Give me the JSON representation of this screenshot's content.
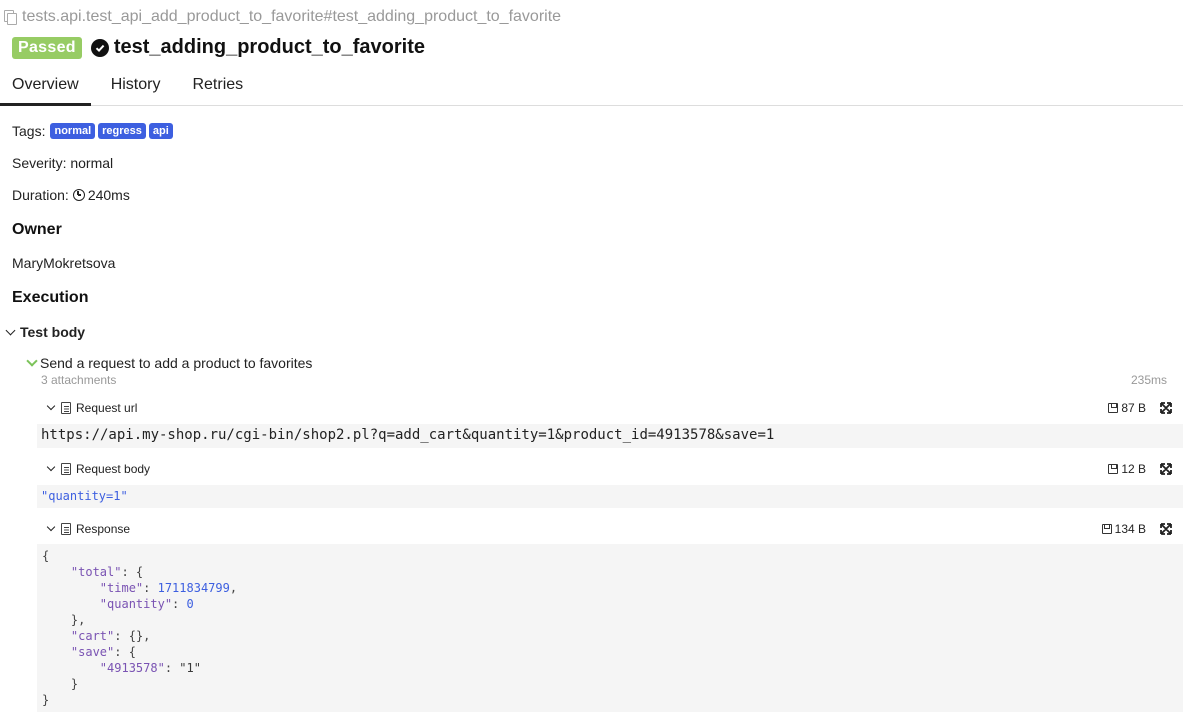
{
  "breadcrumb": "tests.api.test_api_add_product_to_favorite#test_adding_product_to_favorite",
  "status": "Passed",
  "title": "test_adding_product_to_favorite",
  "tabs": [
    "Overview",
    "History",
    "Retries"
  ],
  "tags_label": "Tags:",
  "tags": [
    "normal",
    "regress",
    "api"
  ],
  "severity": "Severity: normal",
  "duration_label": "Duration:",
  "duration_value": "240ms",
  "owner_heading": "Owner",
  "owner": "MaryMokretsova",
  "execution_heading": "Execution",
  "test_body": "Test body",
  "step": {
    "name": "Send a request to add a product to favorites",
    "attachments": "3 attachments",
    "time": "235ms"
  },
  "attachments": [
    {
      "name": "Request url",
      "size": "87 B",
      "content": "https://api.my-shop.ru/cgi-bin/shop2.pl?q=add_cart&quantity=1&product_id=4913578&save=1"
    },
    {
      "name": "Request body",
      "size": "12 B",
      "content": "\"quantity=1\""
    },
    {
      "name": "Response",
      "size": "134 B"
    }
  ],
  "response_json": {
    "total_key": "\"total\"",
    "time_key": "\"time\"",
    "time_val": "1711834799",
    "quantity_key": "\"quantity\"",
    "quantity_val": "0",
    "cart_key": "\"cart\"",
    "save_key": "\"save\"",
    "product_key": "\"4913578\"",
    "product_val": "\"1\""
  },
  "colors": {
    "passed": "#97cc64",
    "tag": "#3d5fe0",
    "caret_green": "#7cc35a"
  }
}
